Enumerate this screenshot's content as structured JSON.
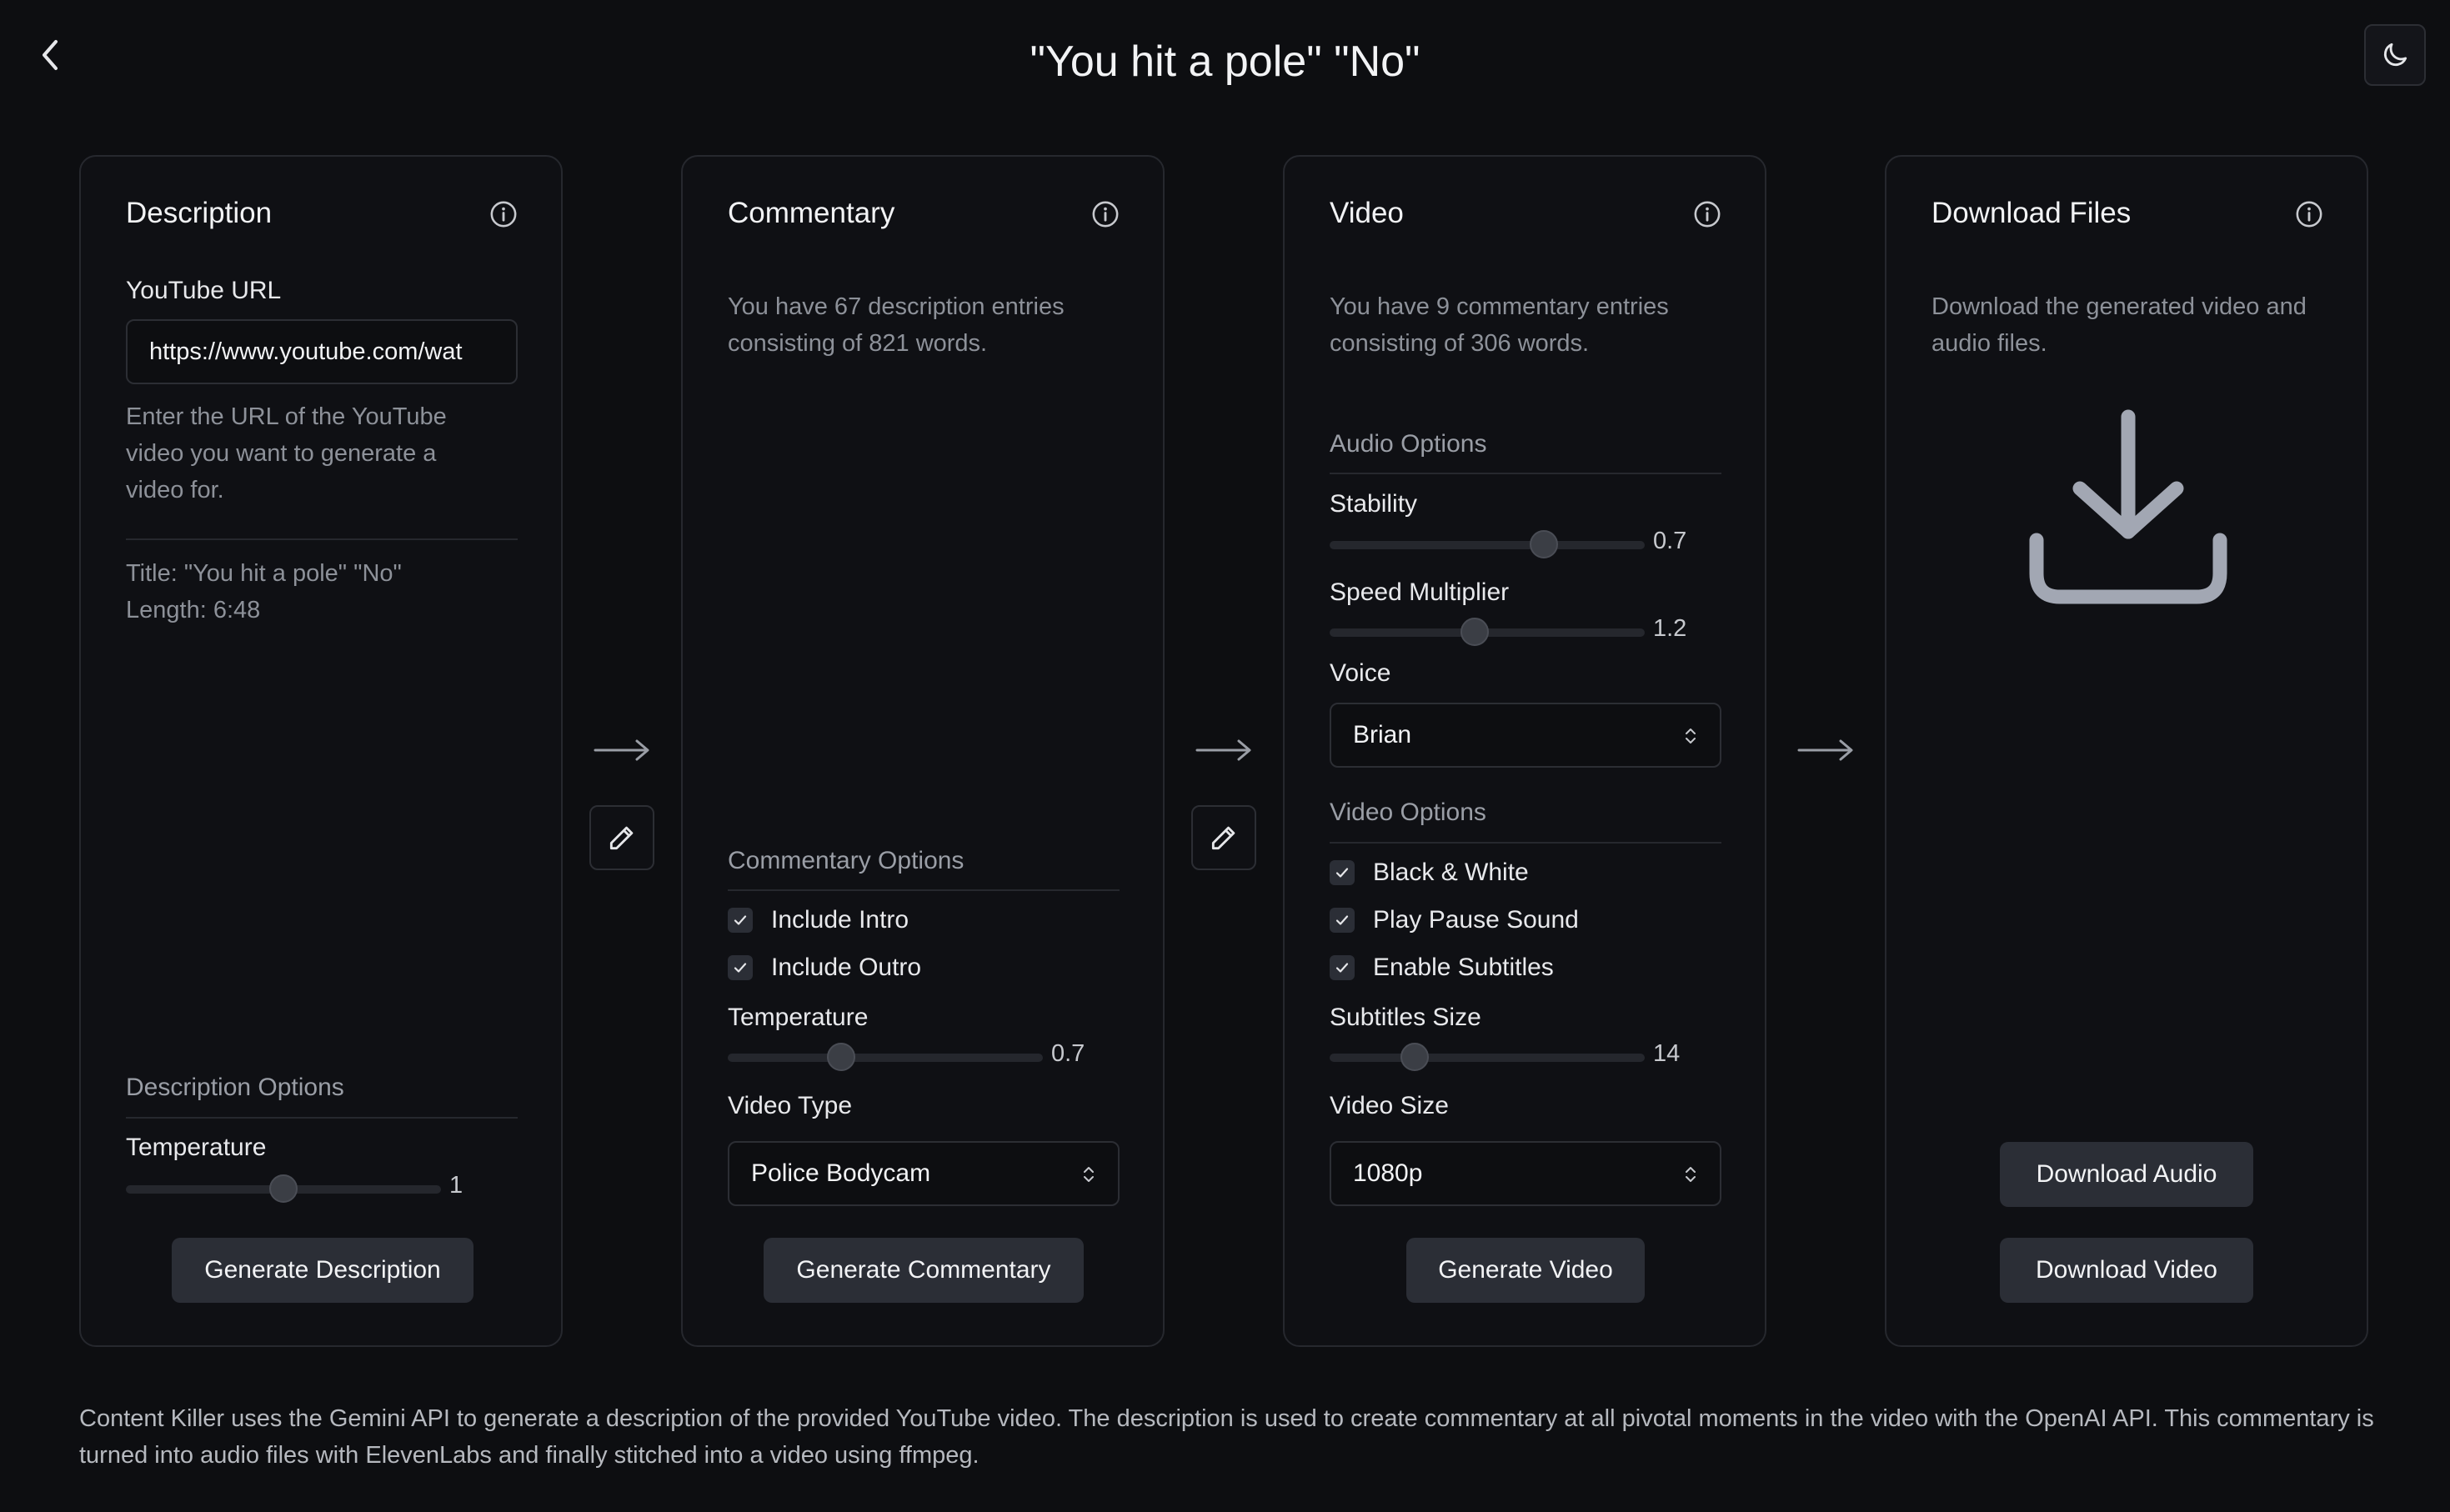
{
  "header": {
    "title": "\"You hit a pole\" \"No\""
  },
  "description": {
    "title": "Description",
    "url_label": "YouTube URL",
    "url_value": "https://www.youtube.com/wat",
    "url_help": "Enter the URL of the YouTube video you want to generate a video for.",
    "meta_title": "Title: \"You hit a pole\" \"No\"",
    "meta_length": "Length: 6:48",
    "options_title": "Description Options",
    "temperature_label": "Temperature",
    "temperature_value": "1",
    "temperature_fraction": 0.5,
    "generate_label": "Generate Description"
  },
  "commentary": {
    "title": "Commentary",
    "summary": "You have 67 description entries consisting of 821 words.",
    "options_title": "Commentary Options",
    "include_intro_label": "Include Intro",
    "include_intro_checked": true,
    "include_outro_label": "Include Outro",
    "include_outro_checked": true,
    "temperature_label": "Temperature",
    "temperature_value": "0.7",
    "temperature_fraction": 0.36,
    "video_type_label": "Video Type",
    "video_type_value": "Police Bodycam",
    "generate_label": "Generate Commentary"
  },
  "video": {
    "title": "Video",
    "summary": "You have 9 commentary entries consisting of 306 words.",
    "audio_options_title": "Audio Options",
    "stability_label": "Stability",
    "stability_value": "0.7",
    "stability_fraction": 0.68,
    "speed_label": "Speed Multiplier",
    "speed_value": "1.2",
    "speed_fraction": 0.46,
    "voice_label": "Voice",
    "voice_value": "Brian",
    "video_options_title": "Video Options",
    "black_white_label": "Black & White",
    "black_white_checked": true,
    "pause_sound_label": "Play Pause Sound",
    "pause_sound_checked": true,
    "subtitles_label": "Enable Subtitles",
    "subtitles_checked": true,
    "subtitles_size_label": "Subtitles Size",
    "subtitles_size_value": "14",
    "subtitles_size_fraction": 0.27,
    "video_size_label": "Video Size",
    "video_size_value": "1080p",
    "generate_label": "Generate Video"
  },
  "download": {
    "title": "Download Files",
    "summary": "Download the generated video and audio files.",
    "audio_label": "Download Audio",
    "video_label": "Download Video"
  },
  "footer": {
    "text": "Content Killer uses the Gemini API to generate a description of the provided YouTube video. The description is used to create commentary at all pivotal moments in the video with the OpenAI API. This commentary is turned into audio files with ElevenLabs and finally stitched into a video using ffmpeg."
  },
  "icons": {
    "back": "chevron-left-icon",
    "theme": "moon-icon",
    "info": "info-icon",
    "arrow": "arrow-right-icon",
    "edit": "pencil-icon",
    "select": "chevron-up-down-icon",
    "check": "check-icon",
    "download": "download-icon"
  }
}
